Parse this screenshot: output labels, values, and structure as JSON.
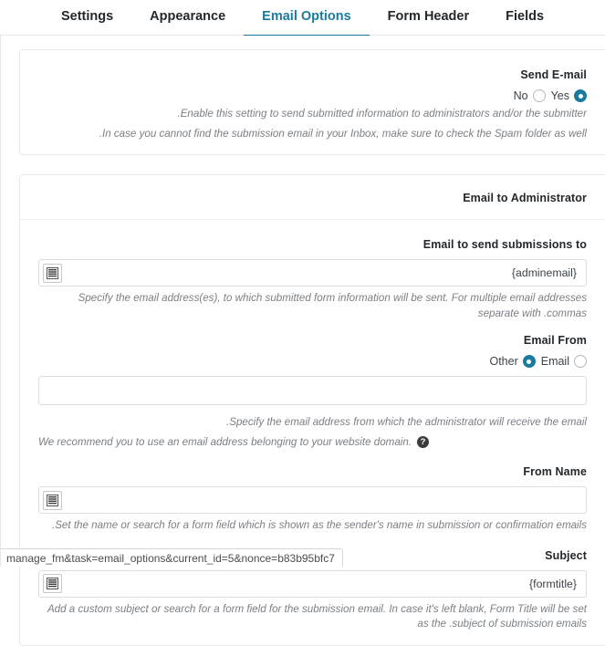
{
  "tabs": [
    {
      "label": "Settings",
      "active": false
    },
    {
      "label": "Appearance",
      "active": false
    },
    {
      "label": "Email Options",
      "active": true
    },
    {
      "label": "Form Header",
      "active": false
    },
    {
      "label": "Fields",
      "active": false
    }
  ],
  "colors": {
    "accent": "#1b7b9e",
    "text": "#23282d",
    "muted": "#7b7f85",
    "border": "#e9e9e9"
  },
  "send_email": {
    "title": "Send E-mail",
    "options": {
      "no_label": "No",
      "yes_label": "Yes",
      "selected": "Yes"
    },
    "desc_line1": ".Enable this setting to send submitted information to administrators and/or the submitter",
    "desc_line2": ".In case you cannot find the submission email in your Inbox, make sure to check the Spam folder as well"
  },
  "admin_panel": {
    "title": "Email to Administrator",
    "fields": {
      "email_to": {
        "label": "Email to send submissions to",
        "value": "{adminemail}",
        "placeholder": "",
        "icon": "form-field-list-icon",
        "desc": "Specify the email address(es), to which submitted form information will be sent. For multiple email addresses separate with .commas"
      },
      "email_from": {
        "label": "Email From",
        "options": {
          "other_label": "Other",
          "email_label": "Email",
          "selected": "Other"
        },
        "value": "",
        "placeholder": "",
        "desc_line1": ".Specify the email address from which the administrator will receive the email",
        "desc_line2": ".We recommend you to use an email address belonging to your website domain",
        "help_icon": "question-mark-icon"
      },
      "from_name": {
        "label": "From Name",
        "value": "",
        "placeholder": "",
        "icon": "form-field-list-icon",
        "desc": ".Set the name or search for a form field which is shown as the sender's name in submission or confirmation emails"
      },
      "subject": {
        "label": "Subject",
        "value": "{formtitle}",
        "placeholder": "",
        "icon": "form-field-list-icon",
        "desc": "Add a custom subject or search for a form field for the submission email. In case it's left blank, Form Title will be set as the .subject of submission emails"
      }
    }
  },
  "statusbar": {
    "url": "manage_fm&task=email_options&current_id=5&nonce=b83b95bfc7"
  }
}
